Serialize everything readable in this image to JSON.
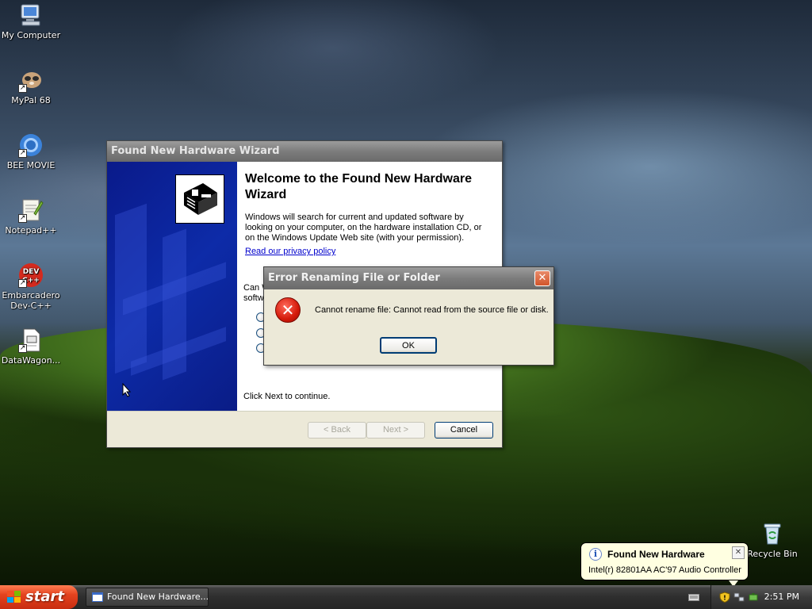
{
  "desktop": {
    "icons": [
      {
        "label": "My Computer"
      },
      {
        "label": "MyPal 68"
      },
      {
        "label": "BEE MOVIE"
      },
      {
        "label": "Notepad++"
      },
      {
        "label": "Embarcadero Dev-C++"
      },
      {
        "label": "DataWagon..."
      },
      {
        "label": "Recycle Bin"
      }
    ]
  },
  "wizard": {
    "title": "Found New Hardware Wizard",
    "heading": "Welcome to the Found New Hardware Wizard",
    "body": "Windows will search for current and updated software by looking on your computer, on the hardware installation CD, or on the Windows Update Web site (with your permission).",
    "privacy_link": "Read our privacy policy",
    "partial_question": "Can W​softw",
    "partial_line1": "Can W",
    "partial_line2": "softw",
    "continue_text": "Click Next to continue.",
    "back_label": "< Back",
    "next_label": "Next >",
    "cancel_label": "Cancel"
  },
  "error_dialog": {
    "title": "Error Renaming File or Folder",
    "message": "Cannot rename file: Cannot read from the source file or disk.",
    "ok_label": "OK",
    "close_glyph": "✕"
  },
  "balloon": {
    "title": "Found New Hardware",
    "text": "Intel(r) 82801AA AC'97 Audio Controller",
    "close_glyph": "✕"
  },
  "taskbar": {
    "start_label": "start",
    "task_label": "Found New Hardware...",
    "clock": "2:51 PM"
  },
  "colors": {
    "xp_blue": "#0d2ba8",
    "start_orange": "#e4431f",
    "balloon_bg": "#ffffe1",
    "error_red": "#d41a0a"
  }
}
